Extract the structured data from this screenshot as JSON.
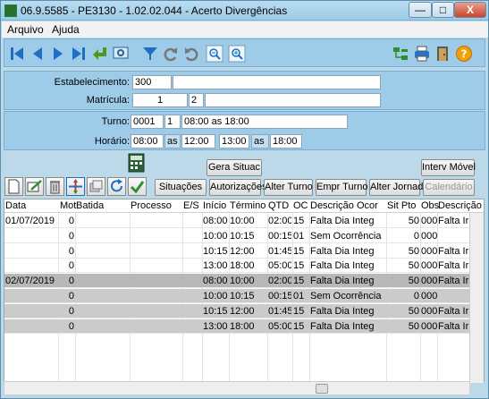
{
  "window": {
    "title": "06.9.5585 - PE3130 - 1.02.02.044 - Acerto Divergências",
    "min": "—",
    "max": "□",
    "close": "X"
  },
  "menu": {
    "arquivo": "Arquivo",
    "ajuda": "Ajuda"
  },
  "form": {
    "estab_label": "Estabelecimento:",
    "estab_value": "300",
    "estab_name": "",
    "matricula_label": "Matrícula:",
    "matricula_value": "1",
    "matricula_seq": "2",
    "matricula_name": "",
    "turno_label": "Turno:",
    "turno_code": "0001",
    "turno_num": "1",
    "turno_desc": "08:00 as 18:00",
    "horario_label": "Horário:",
    "h1": "08:00",
    "as1": "as",
    "h2": "12:00",
    "h3": "13:00",
    "as2": "as",
    "h4": "18:00"
  },
  "buttons": {
    "gera": "Gera Situac",
    "interv": "Interv Móvel",
    "situacoes": "Situações",
    "autorizacoes": "Autorizações",
    "alter_turno": "Alter Turno",
    "empr_turno": "Empr Turno",
    "alter_jornada": "Alter Jornada",
    "calendario": "Calendário"
  },
  "grid": {
    "headers": [
      "Data",
      "Mot",
      "Batida",
      "Processo",
      "E/S",
      "Início",
      "Término",
      "QTD",
      "OC",
      "Descrição Ocor",
      "Sit Pto",
      "Obs",
      "Descrição"
    ],
    "rows": [
      [
        "01/07/2019",
        "0",
        "",
        "",
        "",
        "08:00",
        "10:00",
        "02:00",
        "15",
        "Falta Dia Integ",
        "50",
        "0000",
        "Falta Ir"
      ],
      [
        "",
        "0",
        "",
        "",
        "",
        "10:00",
        "10:15",
        "00:15",
        "01",
        "Sem Ocorrência",
        "0",
        "0000",
        ""
      ],
      [
        "",
        "0",
        "",
        "",
        "",
        "10:15",
        "12:00",
        "01:45",
        "15",
        "Falta Dia Integ",
        "50",
        "0000",
        "Falta Ir"
      ],
      [
        "",
        "0",
        "",
        "",
        "",
        "13:00",
        "18:00",
        "05:00",
        "15",
        "Falta Dia Integ",
        "50",
        "0000",
        "Falta Ir"
      ],
      [
        "02/07/2019",
        "0",
        "",
        "",
        "",
        "08:00",
        "10:00",
        "02:00",
        "15",
        "Falta Dia Integ",
        "50",
        "0000",
        "Falta Ir"
      ],
      [
        "",
        "0",
        "",
        "",
        "",
        "10:00",
        "10:15",
        "00:15",
        "01",
        "Sem Ocorrência",
        "0",
        "0000",
        ""
      ],
      [
        "",
        "0",
        "",
        "",
        "",
        "10:15",
        "12:00",
        "01:45",
        "15",
        "Falta Dia Integ",
        "50",
        "0000",
        "Falta Ir"
      ],
      [
        "",
        "0",
        "",
        "",
        "",
        "13:00",
        "18:00",
        "05:00",
        "15",
        "Falta Dia Integ",
        "50",
        "0000",
        "Falta Ir"
      ]
    ]
  }
}
